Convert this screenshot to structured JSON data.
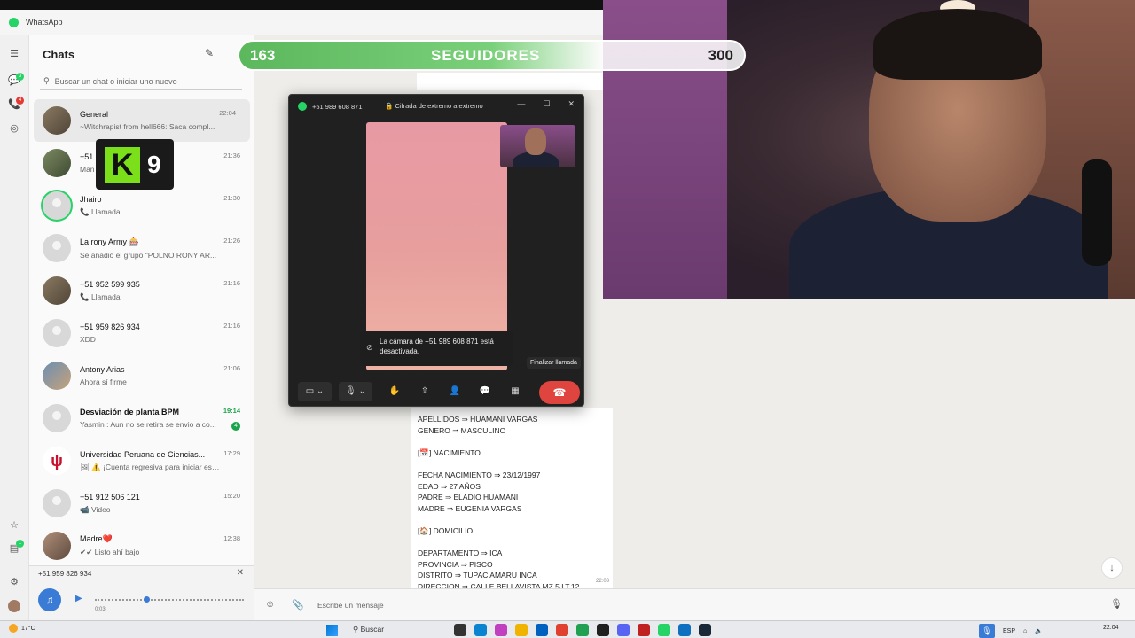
{
  "app": {
    "title": "WhatsApp"
  },
  "sidebar": {
    "title": "Chats",
    "new_chat_icon": "compose-icon",
    "search_placeholder": "Buscar un chat o iniciar uno nuevo",
    "rail_badges": [
      "3",
      "4",
      "1"
    ]
  },
  "chats": [
    {
      "name": "General",
      "message": "~Witchrapist from hell666: Saca compl...",
      "time": "22:04",
      "avatar": "photo"
    },
    {
      "name": "+51",
      "message": "Man",
      "time": "21:36",
      "avatar": "photo2"
    },
    {
      "name": "Jhairo",
      "message": "📞 Llamada",
      "time": "21:30",
      "avatar": "ring"
    },
    {
      "name": "La rony Army 🎰",
      "message": "Se añadió el grupo \"POLNO RONY AR...",
      "time": "21:26",
      "avatar": "default"
    },
    {
      "name": "+51 952 599 935",
      "message": "📞 Llamada",
      "time": "21:16",
      "avatar": "photo"
    },
    {
      "name": "+51 959 826 934",
      "message": "XDD",
      "time": "21:16",
      "avatar": "default"
    },
    {
      "name": "Antony Arias",
      "message": "Ahora sí firme",
      "time": "21:06",
      "avatar": "photo3"
    },
    {
      "name": "Desviación de planta BPM",
      "message": "Yasmin : Aun no se retira se envio a co...",
      "time": "19:14",
      "avatar": "default",
      "unread": "4"
    },
    {
      "name": "Universidad Peruana de Ciencias...",
      "message": "🖼 ⚠️ ¡Cuenta regresiva para iniciar est...",
      "time": "17:29",
      "avatar": "uni"
    },
    {
      "name": "+51 912 506 121",
      "message": "📹 Video",
      "time": "15:20",
      "avatar": "default"
    },
    {
      "name": "Madre❤️",
      "message": "✔✔ Listo ahí bajo",
      "time": "12:38",
      "avatar": "photo4"
    }
  ],
  "k9_overlay": {
    "letter": "K",
    "number": "9"
  },
  "audio_player": {
    "number": "+51 959 826 934",
    "elapsed": "0:03",
    "progress": 0.33
  },
  "followers": {
    "current": "163",
    "label": "SEGUIDORES",
    "goal": "300"
  },
  "call": {
    "number": "+51 989 608 871",
    "encryption": "Cifrada de extremo a extremo",
    "camera_off_notice": "La cámara de +51 989 608 871 está desactivada.",
    "end_call_tooltip": "Finalizar llamada",
    "end_call_color": "#e0443e"
  },
  "message": {
    "lines": [
      "APELLIDOS ⇒ HUAMANI VARGAS",
      "GENERO ⇒ MASCULINO",
      "",
      "[📅] NACIMIENTO",
      "",
      "FECHA NACIMIENTO ⇒ 23/12/1997",
      "EDAD ⇒ 27 AÑOS",
      "PADRE ⇒ ELADIO HUAMANI",
      "MADRE ⇒ EUGENIA VARGAS",
      "",
      "[🏠] DOMICILIO",
      "",
      "DEPARTAMENTO ⇒ ICA",
      "PROVINCIA ⇒ PISCO",
      "DISTRITO ⇒ TUPAC AMARU INCA",
      "DIRECCION ⇒ CALLE BELLAVISTA MZ.5 LT.12"
    ],
    "time": "22:03"
  },
  "compose": {
    "placeholder": "Escribe un mensaje"
  },
  "taskbar": {
    "temperature": "17°C",
    "search": "Buscar",
    "lang": "ESP",
    "time": "22:04"
  }
}
